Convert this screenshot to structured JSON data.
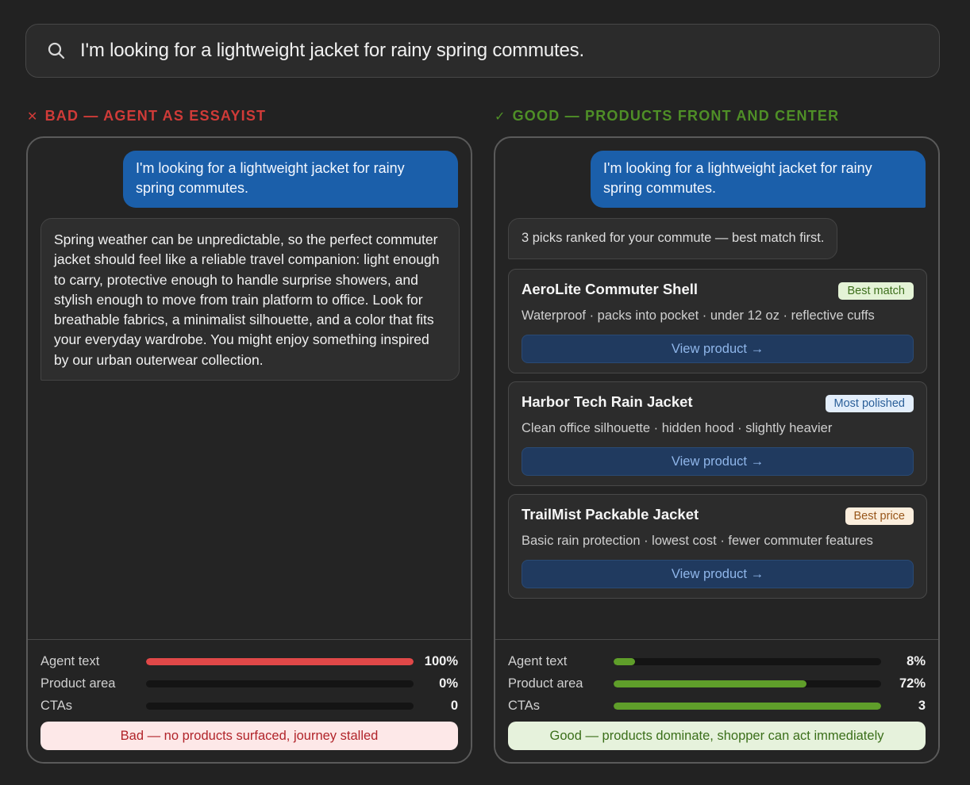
{
  "search": {
    "query": "I'm looking for a lightweight jacket for rainy spring commutes."
  },
  "bad": {
    "mark": "✕",
    "heading": "BAD — AGENT AS ESSAYIST",
    "user_message": "I'm looking for a lightweight jacket for rainy spring commutes.",
    "agent_message": "Spring weather can be unpredictable, so the perfect commuter jacket should feel like a reliable travel companion: light enough to carry, protective enough to handle surprise showers, and stylish enough to move from train platform to office. Look for breathable fabrics, a minimalist silhouette, and a color that fits your everyday wardrobe. You might enjoy something inspired by our urban outerwear collection.",
    "metrics": [
      {
        "label": "Agent text",
        "value": "100%",
        "fraction": 1.0
      },
      {
        "label": "Product area",
        "value": "0%",
        "fraction": 0.0
      },
      {
        "label": "CTAs",
        "value": "0",
        "fraction": 0.0
      }
    ],
    "verdict": "Bad — no products surfaced, journey stalled",
    "bar_color": "#e04848"
  },
  "good": {
    "mark": "✓",
    "heading": "GOOD — PRODUCTS FRONT AND CENTER",
    "user_message": "I'm looking for a lightweight jacket for rainy spring commutes.",
    "summary": "3 picks ranked for your commute — best match first.",
    "products": [
      {
        "name": "AeroLite Commuter Shell",
        "badge": "Best match",
        "badge_bg": "#e4f3d6",
        "badge_fg": "#3d6f1c",
        "desc": "Waterproof · packs into pocket · under 12 oz · reflective cuffs",
        "cta": "View product →"
      },
      {
        "name": "Harbor Tech Rain Jacket",
        "badge": "Most polished",
        "badge_bg": "#e3eefb",
        "badge_fg": "#2b5f99",
        "desc": "Clean office silhouette · hidden hood · slightly heavier",
        "cta": "View product →"
      },
      {
        "name": "TrailMist Packable Jacket",
        "badge": "Best price",
        "badge_bg": "#fbeedd",
        "badge_fg": "#98561a",
        "desc": "Basic rain protection · lowest cost · fewer commuter features",
        "cta": "View product →"
      }
    ],
    "metrics": [
      {
        "label": "Agent text",
        "value": "8%",
        "fraction": 0.08
      },
      {
        "label": "Product area",
        "value": "72%",
        "fraction": 0.72
      },
      {
        "label": "CTAs",
        "value": "3",
        "fraction": 1.0
      }
    ],
    "verdict": "Good — products dominate, shopper can act immediately",
    "bar_color": "#5f9e2a"
  }
}
